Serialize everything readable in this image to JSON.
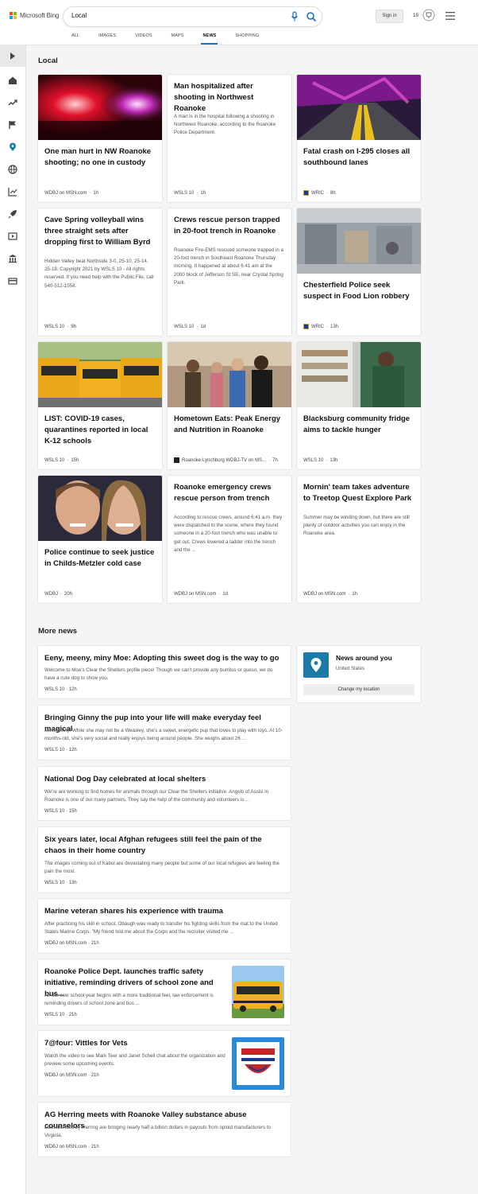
{
  "header": {
    "logo_text": "Microsoft Bing",
    "search_value": "Local",
    "signin_label": "Sign in",
    "rewards_count": "15",
    "tabs": [
      "ALL",
      "IMAGES",
      "VIDEOS",
      "MAPS",
      "NEWS",
      "SHOPPING"
    ],
    "active_tab": "NEWS"
  },
  "colors": {
    "accent": "#1a73c6",
    "nay_icon_bg": "#1a7ba8",
    "logo": [
      "#f25022",
      "#7fba00",
      "#00a4ef",
      "#ffb900"
    ]
  },
  "local": {
    "title": "Local",
    "cards": [
      {
        "title": "One man hurt in NW Roanoke shooting; no one in custody",
        "source": "WDBJ on MSN.com",
        "age": "1h",
        "image": "police-lights"
      },
      {
        "title": "Man hospitalized after shooting in Northwest Roanoke",
        "snippet": "A man is in the hospital following a shooting in Northwest Roanoke, according to the Roanoke Police Department.",
        "source": "WSLS 10",
        "age": "1h"
      },
      {
        "title": "Fatal crash on I-295 closes all southbound lanes",
        "source": "WRIC",
        "age": "8h",
        "image": "road-lights"
      },
      {
        "title": "Cave Spring volleyball wins three straight sets after dropping first to William Byrd",
        "snippet": "Hidden Valley beat Northside 3-0, 25-10, 25-14, 25-18. Copyright 2021 by WSLS 10 - All rights reserved. If you need help with the Public File, call 540-512-1558.",
        "source": "WSLS 10",
        "age": "9h"
      },
      {
        "title": "Crews rescue person trapped in 20-foot trench in Roanoke",
        "snippet": "Roanoke Fire-EMS rescued someone trapped in a 20-foot trench in Southeast Roanoke Thursday morning. It happened at about 6:41 am at the 2000 block of Jefferson St SE, near Crystal Spring Park.",
        "source": "WSLS 10",
        "age": "1d"
      },
      {
        "title": "Chesterfield Police seek suspect in Food Lion robbery",
        "source": "WRIC",
        "age": "13h",
        "image": "store-camera"
      },
      {
        "title": "LIST: COVID-19 cases, quarantines reported in local K-12 schools",
        "source": "WSLS 10",
        "age": "15h",
        "image": "school-buses"
      },
      {
        "title": "Hometown Eats: Peak Energy and Nutrition in Roanoke",
        "source": "Roanoke-Lynchburg WDBJ-TV on MS...",
        "age": "7h",
        "image": "group-photo"
      },
      {
        "title": "Blacksburg community fridge aims to tackle hunger",
        "source": "WSLS 10",
        "age": "13h",
        "image": "fridge"
      },
      {
        "title": "Police continue to seek justice in Childs-Metzler cold case",
        "source": "WDBJ",
        "age": "20h",
        "image": "couple"
      },
      {
        "title": "Roanoke emergency crews rescue person from trench",
        "snippet": "According to rescue crews, around 6:41 a.m. they were dispatched to the scene, where they found someone in a 20-foot trench who was unable to get out. Crews lowered a ladder into the trench and the ...",
        "source": "WDBJ on MSN.com",
        "age": "1d"
      },
      {
        "title": "Mornin' team takes adventure to Treetop Quest Explore Park",
        "snippet": "Summer may be winding down, but there are still plenty of outdoor activities you can enjoy in the Roanoke area.",
        "source": "WDBJ on MSN.com",
        "age": "1h"
      }
    ]
  },
  "more_news": {
    "title": "More news",
    "items": [
      {
        "title": "Eeny, meeny, miny Moe: Adopting this sweet dog is the way to go",
        "snippet": "Welcome to Moe's Clear the Shelters profile piece! Though we can't provide any burritos or queso, we do have a cute dog to show you.",
        "source": "WSLS 10",
        "age": "12h"
      },
      {
        "title": "Bringing Ginny the pup into your life will make everyday feel magical",
        "snippet": "Meet Ginny! While she may not be a Weasley, she's a sweet, energetic pup that loves to play with toys. At 10-months-old, she's very social and really enjoys being around people. She weighs about 26 ...",
        "source": "WSLS 10",
        "age": "12h"
      },
      {
        "title": "National Dog Day celebrated at local shelters",
        "snippet": "We're are working to find homes for animals through our Clear the Shelters initiative. Angels of Assisi in Roanoke is one of our many partners. They say the help of the community and volunteers is ...",
        "source": "WSLS 10",
        "age": "15h"
      },
      {
        "title": "Six years later, local Afghan refugees still feel the pain of the chaos in their home country",
        "snippet": "The images coming out of Kabul are devastating many people but some of our local refugees are feeling the pain the most.",
        "source": "WSLS 10",
        "age": "13h"
      },
      {
        "title": "Marine veteran shares his experience with trauma",
        "snippet": "After practicing his skill in school, Obaugh was ready to transfer his fighting skills from the mat to the United States Marine Corps. \"My friend told me about the Corps and the recruiter visited me ...",
        "source": "WDBJ on MSN.com",
        "age": "21h"
      },
      {
        "title": "Roanoke Police Dept. launches traffic safety initiative, reminding drivers of school zone and bus...",
        "snippet": "As the new school year begins with a more traditional feel, law enforcement is reminding drivers of school zone and bus ...",
        "source": "WSLS 10",
        "age": "21h",
        "image": "school-bus"
      },
      {
        "title": "7@four: Vittles for Vets",
        "snippet": "Watch the video to see Mark Teer and Janet Schell chat about the organization and preview some upcoming events.",
        "source": "WDBJ on MSN.com",
        "age": "21h",
        "image": "vets-logo"
      },
      {
        "title": "AG Herring meets with Roanoke Valley substance abuse counselors",
        "snippet": "Lawsuits filed by Herring are bringing nearly half a billion dollars in payouts from opioid manufacturers to Virginia.",
        "source": "WDBJ on MSN.com",
        "age": "21h"
      }
    ]
  },
  "news_around_you": {
    "title": "News around you",
    "location": "United States",
    "button_label": "Change my location"
  }
}
